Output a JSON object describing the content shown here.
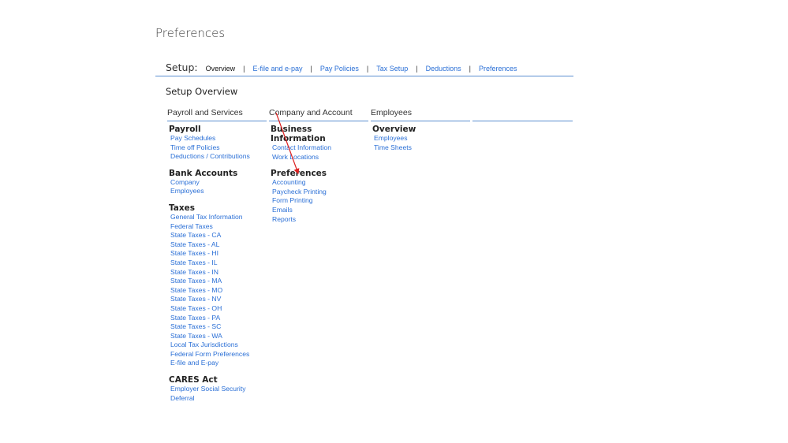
{
  "page_title": "Preferences",
  "setup": {
    "label": "Setup:",
    "tabs": [
      {
        "label": "Overview",
        "current": true
      },
      {
        "label": "E-file and e-pay"
      },
      {
        "label": "Pay Policies"
      },
      {
        "label": "Tax Setup"
      },
      {
        "label": "Deductions"
      },
      {
        "label": "Preferences"
      }
    ],
    "separator": "|"
  },
  "overview_title": "Setup Overview",
  "columns": [
    {
      "header": "Payroll and Services",
      "sections": [
        {
          "title": "Payroll",
          "links": [
            "Pay Schedules",
            "Time off Policies",
            "Deductions / Contributions"
          ]
        },
        {
          "title": "Bank Accounts",
          "links": [
            "Company",
            "Employees"
          ]
        },
        {
          "title": "Taxes",
          "links": [
            "General Tax Information",
            "Federal Taxes",
            "State Taxes - CA",
            "State Taxes - AL",
            "State Taxes - HI",
            "State Taxes - IL",
            "State Taxes - IN",
            "State Taxes - MA",
            "State Taxes - MO",
            "State Taxes - NV",
            "State Taxes - OH",
            "State Taxes - PA",
            "State Taxes - SC",
            "State Taxes - WA",
            "Local Tax Jurisdictions",
            "Federal Form Preferences",
            "E-file and E-pay"
          ]
        },
        {
          "title": "CARES Act",
          "links": [
            "Employer Social Security Deferral"
          ]
        }
      ]
    },
    {
      "header": "Company and Account",
      "sections": [
        {
          "title": "Business Information",
          "links": [
            "Contact Information",
            "Work Locations"
          ]
        },
        {
          "title": "Preferences",
          "links": [
            "Accounting",
            "Paycheck Printing",
            "Form Printing",
            "Emails",
            "Reports"
          ]
        }
      ]
    },
    {
      "header": "Employees",
      "sections": [
        {
          "title": "Overview",
          "links": [
            "Employees",
            "Time Sheets"
          ]
        }
      ]
    }
  ],
  "colors": {
    "link": "#2a6fd6",
    "rule": "#5b8fd0",
    "annotation_arrow": "#d22"
  }
}
